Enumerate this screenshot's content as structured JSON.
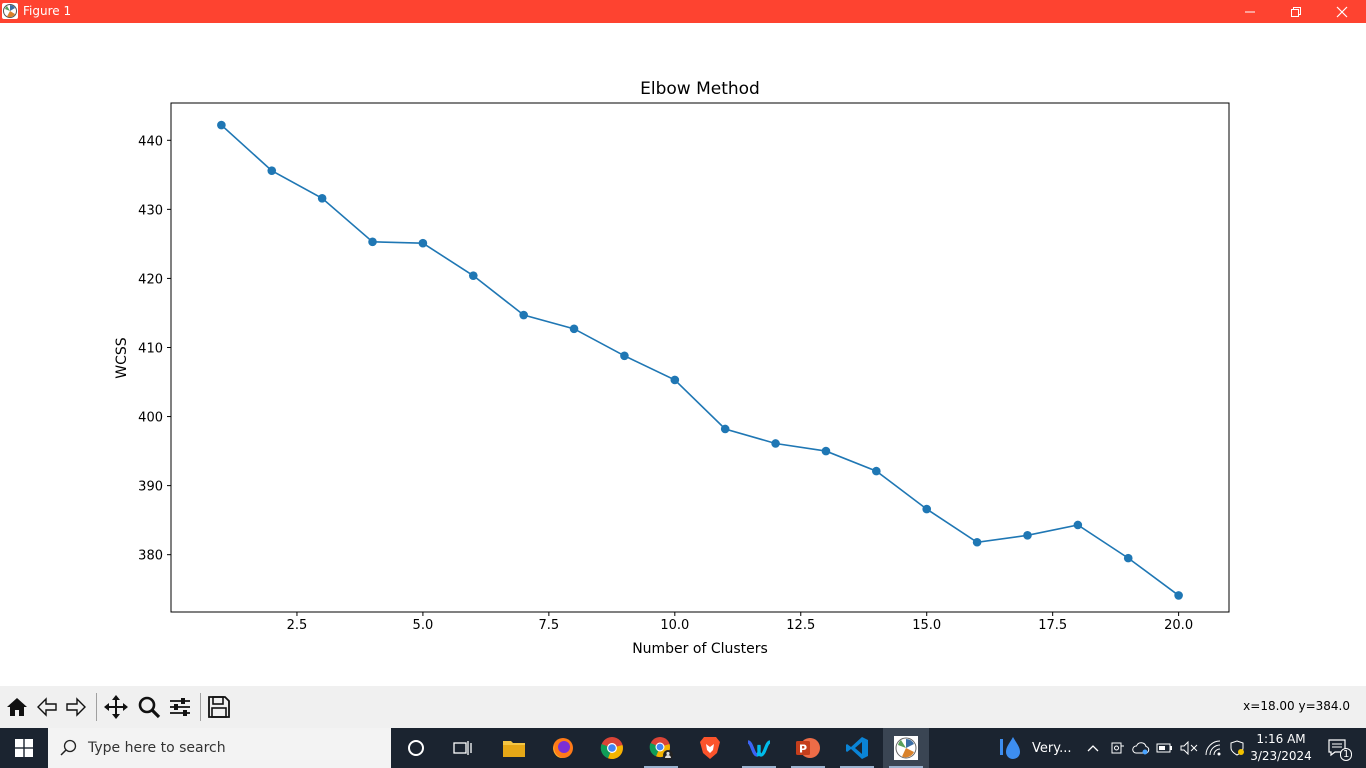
{
  "window": {
    "title": "Figure 1"
  },
  "chart_data": {
    "type": "line",
    "title": "Elbow Method",
    "xlabel": "Number of Clusters",
    "ylabel": "WCSS",
    "x": [
      1,
      2,
      3,
      4,
      5,
      6,
      7,
      8,
      9,
      10,
      11,
      12,
      13,
      14,
      15,
      16,
      17,
      18,
      19,
      20
    ],
    "series": [
      {
        "values": [
          442.2,
          435.6,
          431.6,
          425.3,
          425.1,
          420.4,
          414.7,
          412.7,
          408.8,
          405.3,
          398.2,
          396.1,
          395.0,
          392.1,
          386.6,
          381.8,
          382.8,
          384.3,
          379.5,
          374.1
        ],
        "color": "#1f77b4"
      }
    ],
    "xlim": [
      -0.0,
      21.0
    ],
    "ylim": [
      371.7,
      445.4
    ],
    "xticks": [
      2.5,
      5.0,
      7.5,
      10.0,
      12.5,
      15.0,
      17.5,
      20.0
    ],
    "xtick_labels": [
      "2.5",
      "5.0",
      "7.5",
      "10.0",
      "12.5",
      "15.0",
      "17.5",
      "20.0"
    ],
    "yticks": [
      380,
      390,
      400,
      410,
      420,
      430,
      440
    ],
    "ytick_labels": [
      "380",
      "390",
      "400",
      "410",
      "420",
      "430",
      "440"
    ],
    "marker": "o",
    "grid": false
  },
  "toolbar": {
    "buttons": [
      "home-icon",
      "back-icon",
      "forward-icon",
      "pan-icon",
      "zoom-icon",
      "configure-subplots-icon",
      "save-icon"
    ],
    "coords": "x=18.00 y=384.0"
  },
  "taskbar": {
    "search_placeholder": "Type here to search",
    "weather_text": "Very...",
    "time": "1:16 AM",
    "date": "3/23/2024",
    "notification_count": "1"
  },
  "colors": {
    "titlebar": "#fe4330",
    "line": "#1f77b4",
    "taskbar": "#1b2430"
  }
}
